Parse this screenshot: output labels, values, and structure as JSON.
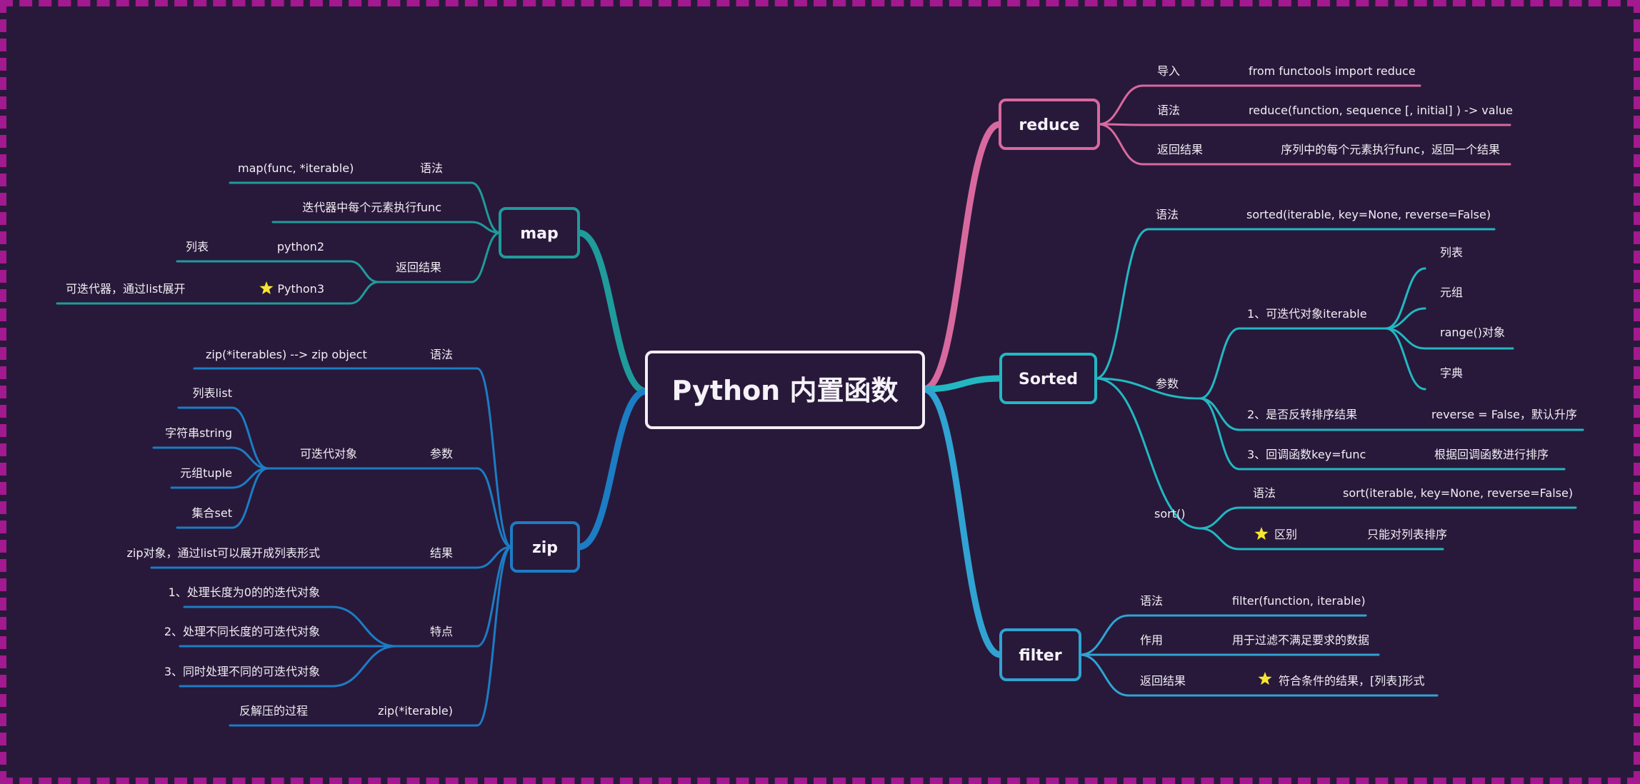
{
  "title": "Python 内置函数",
  "colors": {
    "background": "#28193a",
    "border": "#a3198f",
    "root_border": "#f2eef5",
    "map": "#1f9b9b",
    "zip": "#1c7cc4",
    "reduce": "#d8699f",
    "sorted": "#22b8c2",
    "filter": "#30a3d3",
    "star": "#f7e531",
    "text": "#f2eef5"
  },
  "branches": {
    "map": {
      "label": "map",
      "items": [
        {
          "key": "语法",
          "value": "map(func, *iterable)"
        },
        {
          "key": "",
          "value": "迭代器中每个元素执行func"
        },
        {
          "key": "返回结果",
          "children": [
            {
              "key": "python2",
              "value": "列表",
              "star": false
            },
            {
              "key": "Python3",
              "value": "可迭代器，通过list展开",
              "star": true
            }
          ]
        }
      ]
    },
    "zip": {
      "label": "zip",
      "items": [
        {
          "key": "语法",
          "value": "zip(*iterables) --> zip object"
        },
        {
          "key": "参数",
          "sub": "可迭代对象",
          "children": [
            "列表list",
            "字符串string",
            "元组tuple",
            "集合set"
          ]
        },
        {
          "key": "结果",
          "value": "zip对象，通过list可以展开成列表形式"
        },
        {
          "key": "特点",
          "children": [
            "1、处理长度为0的的迭代对象",
            "2、处理不同长度的可迭代对象",
            "3、同时处理不同的可迭代对象"
          ]
        },
        {
          "key": "zip(*iterable)",
          "value": "反解压的过程"
        }
      ]
    },
    "reduce": {
      "label": "reduce",
      "items": [
        {
          "key": "导入",
          "value": "from functools import reduce"
        },
        {
          "key": "语法",
          "value": "reduce(function, sequence [, initial] ) -> value"
        },
        {
          "key": "返回结果",
          "value": "序列中的每个元素执行func，返回一个结果"
        }
      ]
    },
    "sorted": {
      "label": "Sorted",
      "items": [
        {
          "key": "语法",
          "value": "sorted(iterable, key=None, reverse=False)"
        },
        {
          "key": "参数",
          "children": [
            {
              "key": "1、可迭代对象iterable",
              "children": [
                "列表",
                "元组",
                "range()对象",
                "字典"
              ]
            },
            {
              "key": "2、是否反转排序结果",
              "value": "reverse = False，默认升序"
            },
            {
              "key": "3、回调函数key=func",
              "value": "根据回调函数进行排序"
            }
          ]
        },
        {
          "key": "sort()",
          "children": [
            {
              "key": "语法",
              "value": "sort(iterable, key=None, reverse=False)",
              "star": false
            },
            {
              "key": "区别",
              "value": "只能对列表排序",
              "star": true
            }
          ]
        }
      ]
    },
    "filter": {
      "label": "filter",
      "items": [
        {
          "key": "语法",
          "value": "filter(function, iterable)",
          "star": false
        },
        {
          "key": "作用",
          "value": "用于过滤不满足要求的数据",
          "star": false
        },
        {
          "key": "返回结果",
          "value": "符合条件的结果，[列表]形式",
          "star": true
        }
      ]
    }
  }
}
